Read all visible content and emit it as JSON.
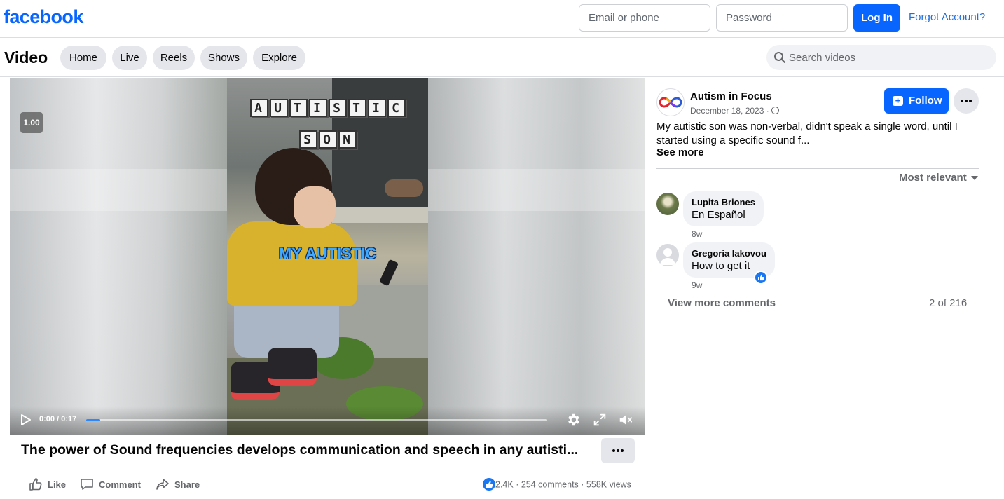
{
  "header": {
    "logo": "facebook",
    "email_placeholder": "Email or phone",
    "password_placeholder": "Password",
    "login_label": "Log In",
    "forgot_label": "Forgot Account?"
  },
  "nav": {
    "title": "Video",
    "tabs": [
      "Home",
      "Live",
      "Reels",
      "Shows",
      "Explore"
    ],
    "search_placeholder": "Search videos"
  },
  "player": {
    "playback_speed": "1.00",
    "overlay_title_line1": "AUTISTIC",
    "overlay_title_line2": "SON",
    "caption": "MY AUTISTIC",
    "time": "0:00 / 0:17",
    "progress": 0.03
  },
  "video": {
    "title": "The power of Sound frequencies develops communication and speech in any autisti...",
    "actions": [
      "Like",
      "Comment",
      "Share"
    ],
    "reactions": "2.4K",
    "comments": "254 comments",
    "views": "558K views"
  },
  "post": {
    "page_name": "Autism in Focus",
    "date": "December 18, 2023 ·",
    "follow_label": "Follow",
    "description": "My autistic son was non-verbal, didn't speak a single word, until I started using a specific sound f...",
    "see_more": "See more",
    "sort_label": "Most relevant"
  },
  "comments": [
    {
      "name": "Lupita Briones",
      "text": "En Español",
      "time": "8w"
    },
    {
      "name": "Gregoria Iakovou",
      "text": "How to get it",
      "time": "9w"
    }
  ],
  "comments_footer": {
    "view_more": "View more comments",
    "count": "2 of 216"
  },
  "colors": {
    "brand": "#0866ff",
    "muted": "#65676b",
    "pill_bg": "#e4e6eb"
  }
}
